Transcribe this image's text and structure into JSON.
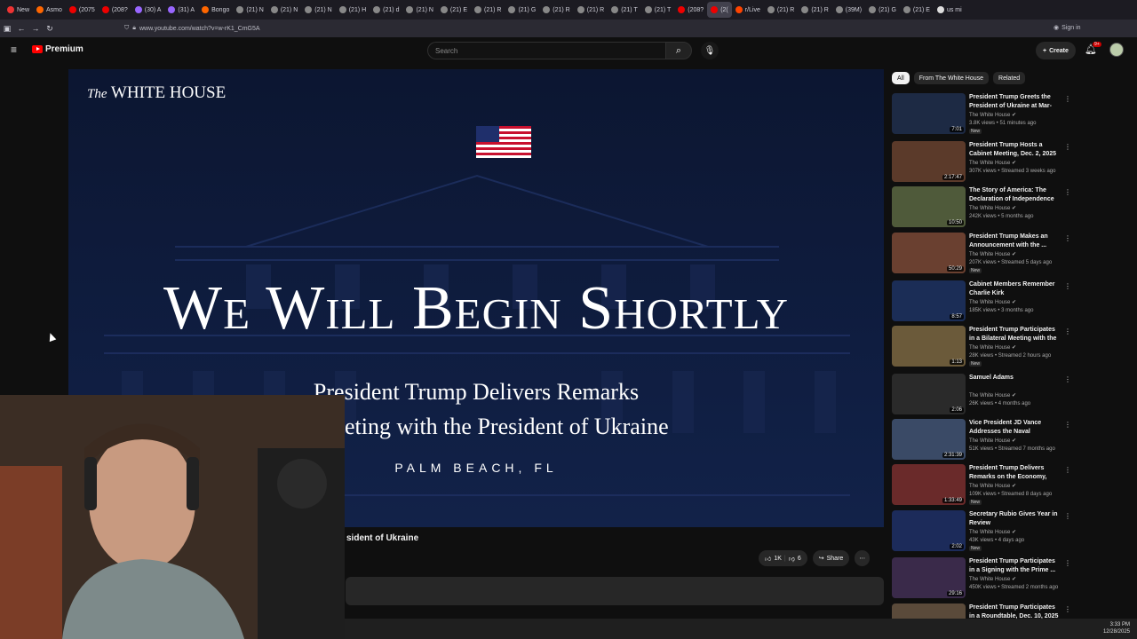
{
  "browser": {
    "tabs": [
      {
        "label": "New",
        "color": "#e33"
      },
      {
        "label": "Asmo",
        "color": "#f60"
      },
      {
        "label": "(2075",
        "color": "#e00"
      },
      {
        "label": "(208?",
        "color": "#e00"
      },
      {
        "label": "(30) A",
        "color": "#96f"
      },
      {
        "label": "(31) A",
        "color": "#96f"
      },
      {
        "label": "Bongo",
        "color": "#f60"
      },
      {
        "label": "(21) N",
        "color": "#888"
      },
      {
        "label": "(21) N",
        "color": "#888"
      },
      {
        "label": "(21) N",
        "color": "#888"
      },
      {
        "label": "(21) H",
        "color": "#888"
      },
      {
        "label": "(21) d",
        "color": "#888"
      },
      {
        "label": "(21) N",
        "color": "#888"
      },
      {
        "label": "(21) E",
        "color": "#888"
      },
      {
        "label": "(21) R",
        "color": "#888"
      },
      {
        "label": "(21) G",
        "color": "#888"
      },
      {
        "label": "(21) R",
        "color": "#888"
      },
      {
        "label": "(21) R",
        "color": "#888"
      },
      {
        "label": "(21) T",
        "color": "#888"
      },
      {
        "label": "(21) T",
        "color": "#888"
      },
      {
        "label": "(208?",
        "color": "#e00"
      },
      {
        "label": "(2(",
        "color": "#e00",
        "active": true
      },
      {
        "label": "r/Live",
        "color": "#f40"
      },
      {
        "label": "(21) R",
        "color": "#888"
      },
      {
        "label": "(21) R",
        "color": "#888"
      },
      {
        "label": "(39M)",
        "color": "#888"
      },
      {
        "label": "(21) G",
        "color": "#888"
      },
      {
        "label": "(21) E",
        "color": "#888"
      },
      {
        "label": "us mi",
        "color": "#ddd"
      }
    ],
    "url": "www.youtube.com/watch?v=w-rK1_CmG5A",
    "sign_in": "Sign in"
  },
  "youtube": {
    "logo_label": "Premium",
    "search_placeholder": "Search",
    "create_label": "Create",
    "notif_count": "9+"
  },
  "video": {
    "overlay_logo": "WHITE HOUSE",
    "overlay_logo_prefix": "The",
    "headline": "We Will Begin Shortly",
    "subtitle_1": "President Trump Delivers Remarks",
    "subtitle_2": "ral Meeting with the President of Ukraine",
    "location": "PALM BEACH, FL",
    "title_visible": "sident of Ukraine",
    "likes": "1K",
    "dislikes": "6",
    "share_label": "Share",
    "accent": "#0f1d40"
  },
  "chips": [
    "All",
    "From The White House",
    "Related"
  ],
  "recommended": [
    {
      "title": "President Trump Greets the President of Ukraine at Mar-a-...",
      "channel": "The White House",
      "meta": "3.8K views • 51 minutes ago",
      "duration": "7:01",
      "badge": "New",
      "bg": "#1d2a44"
    },
    {
      "title": "President Trump Hosts a Cabinet Meeting, Dec. 2, 2025",
      "channel": "The White House",
      "meta": "307K views • Streamed 3 weeks ago",
      "duration": "2:17:47",
      "badge": "",
      "bg": "#5b3a2a"
    },
    {
      "title": "The Story of America: The Declaration of Independence",
      "channel": "The White House",
      "meta": "242K views • 5 months ago",
      "duration": "10:50",
      "badge": "",
      "bg": "#4f5a3a"
    },
    {
      "title": "President Trump Makes an Announcement with the ...",
      "channel": "The White House",
      "meta": "207K views • Streamed 5 days ago",
      "duration": "50:29",
      "badge": "New",
      "bg": "#6a4030"
    },
    {
      "title": "Cabinet Members Remember Charlie Kirk",
      "channel": "The White House",
      "meta": "185K views • 3 months ago",
      "duration": "8:57",
      "badge": "",
      "bg": "#1b2d56"
    },
    {
      "title": "President Trump Participates in a Bilateral Meeting with the ...",
      "channel": "The White House",
      "meta": "28K views • Streamed 2 hours ago",
      "duration": "1:13",
      "badge": "New",
      "bg": "#6b5a3a"
    },
    {
      "title": "Samuel Adams",
      "channel": "The White House",
      "meta": "26K views • 4 months ago",
      "duration": "2:06",
      "badge": "",
      "bg": "#2a2a2a"
    },
    {
      "title": "Vice President JD Vance Addresses the Naval Academy...",
      "channel": "The White House",
      "meta": "51K views • Streamed 7 months ago",
      "duration": "2:31:39",
      "badge": "",
      "bg": "#3a4a66"
    },
    {
      "title": "President Trump Delivers Remarks on the Economy, Dec...",
      "channel": "The White House",
      "meta": "109K views • Streamed 8 days ago",
      "duration": "1:33:49",
      "badge": "New",
      "bg": "#6a2a2a"
    },
    {
      "title": "Secretary Rubio Gives Year in Review",
      "channel": "The White House",
      "meta": "43K views • 4 days ago",
      "duration": "2:02",
      "badge": "New",
      "bg": "#1c2b5a"
    },
    {
      "title": "President Trump Participates in a Signing with the Prime ...",
      "channel": "The White House",
      "meta": "450K views • Streamed 2 months ago",
      "duration": "29:16",
      "badge": "",
      "bg": "#3a2a4a"
    },
    {
      "title": "President Trump Participates in a Roundtable, Dec. 10, 2025",
      "channel": "",
      "meta": "",
      "duration": "",
      "badge": "",
      "bg": "#5a4a3a"
    }
  ],
  "system": {
    "time": "3:33 PM",
    "date": "12/28/2025"
  }
}
